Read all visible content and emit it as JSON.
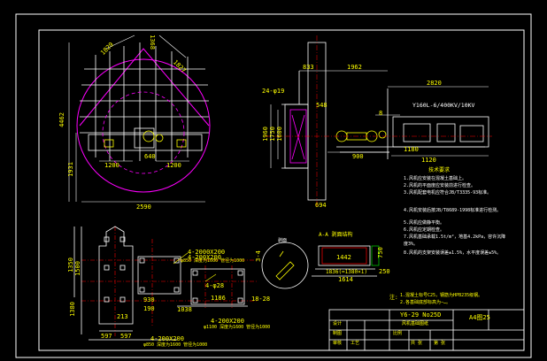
{
  "fan_front": {
    "dims": [
      "1829",
      "1368",
      "1827",
      "4462",
      "1931",
      "1200",
      "1200",
      "2590",
      "640"
    ]
  },
  "fan_side": {
    "dims": [
      "833",
      "1962",
      "2820",
      "24-φ19",
      "548",
      "1960",
      "1750",
      "1600",
      "900",
      "1180",
      "1120",
      "694",
      "8"
    ]
  },
  "motor": {
    "label": "Y160L-6/400KV/10KV"
  },
  "foundation": {
    "dims": [
      "1350",
      "1500",
      "1380",
      "213",
      "597",
      "597",
      "930",
      "1186",
      "1038",
      "190",
      "18-28",
      "4-2000X200",
      "4-200X200",
      "φ850 深度为1600 管径为1000",
      "4-200X200",
      "φ1100 深度为1600 管径为1000",
      "4-200X200",
      "φ850 深度为1600 管径为1000",
      "3-4",
      "4-φ28"
    ]
  },
  "section_a": {
    "title": "A-A 剥面结构",
    "dims": [
      "1442",
      "750",
      "1836(=1380×1)",
      "1614",
      "250"
    ]
  },
  "section_d": {
    "label": "剥面"
  },
  "notes": {
    "title": "技术要求",
    "items": [
      "1.风机应安装在混凝土基础上。",
      "2.风机的平面度应安装前进行检查。",
      "3.风机配套电机应符合JB/T3335-93标准。",
      "4.风机安装后按JB/T8689-1998标准进行检测。",
      "5.风机应做静平衡。",
      "6.风机应定期检查。",
      "7.风机基础承载1.5t/m²，地基4.2kPa，容许沉降",
      "  度3%。",
      "8.风机的支架安装误差±1.5%，水平度误差±5%。"
    ],
    "footnote_1": "1.混凝土标号C25，钢筋为HPB235级钢。",
    "footnote_2": "2.各基础底部标高为−…。",
    "footnote_mark": "注:"
  },
  "title_block": {
    "model": "Y6-29 No25D",
    "subtitle": "风机基础图纸",
    "drawing_no": "A4图25",
    "rows": [
      "设计",
      "制图",
      "审核",
      "工艺"
    ],
    "cells": [
      "比例",
      "共 张",
      "第 张"
    ]
  },
  "colors": {
    "white": "#ffffff",
    "yellow": "#ffff00",
    "magenta": "#ff00ff",
    "green": "#00ff00",
    "cyan": "#00ffff",
    "red": "#ff0000"
  }
}
